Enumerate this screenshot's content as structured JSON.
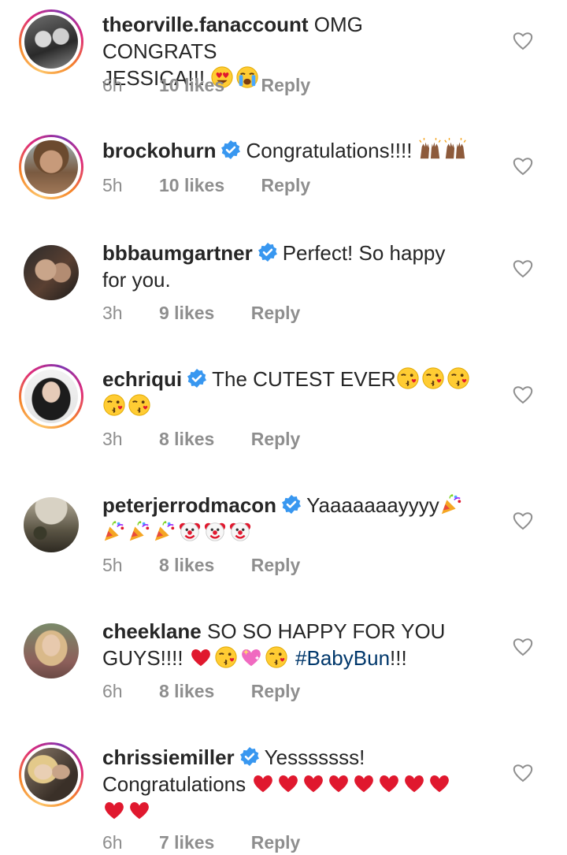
{
  "colors": {
    "text": "#262626",
    "meta": "#8e8e8e",
    "verified": "#3897f0",
    "hashtag": "#00376b",
    "heart_red": "#e0182e"
  },
  "comments": [
    {
      "username": "theorville.fanaccount",
      "verified": false,
      "has_story_ring": true,
      "text": "OMG CONGRATS JESSICA!!!",
      "emojis": [
        "heart-eyes-emoji",
        "loudly-crying-emoji"
      ],
      "time": "6h",
      "likes": "10 likes",
      "reply": "Reply"
    },
    {
      "username": "brockohurn",
      "verified": true,
      "has_story_ring": true,
      "text": "Congratulations!!!!",
      "emojis": [
        "raising-hands-emoji",
        "raising-hands-emoji"
      ],
      "time": "5h",
      "likes": "10 likes",
      "reply": "Reply"
    },
    {
      "username": "bbbaumgartner",
      "verified": true,
      "has_story_ring": false,
      "text": "Perfect!  So happy for you.",
      "emojis": [],
      "time": "3h",
      "likes": "9 likes",
      "reply": "Reply"
    },
    {
      "username": "echriqui",
      "verified": true,
      "has_story_ring": true,
      "text": "The CUTEST EVER",
      "emojis": [
        "kissing-heart-emoji",
        "kissing-heart-emoji",
        "kissing-heart-emoji",
        "kissing-heart-emoji",
        "kissing-heart-emoji"
      ],
      "time": "3h",
      "likes": "8 likes",
      "reply": "Reply"
    },
    {
      "username": "peterjerrodmacon",
      "verified": true,
      "has_story_ring": false,
      "text": "Yaaaaaaayyyy",
      "emojis": [
        "party-popper-emoji",
        "party-popper-emoji",
        "party-popper-emoji",
        "party-popper-emoji",
        "clown-emoji",
        "clown-emoji",
        "clown-emoji"
      ],
      "time": "5h",
      "likes": "8 likes",
      "reply": "Reply"
    },
    {
      "username": "cheeklane",
      "verified": false,
      "has_story_ring": false,
      "text": "SO SO HAPPY FOR YOU GUYS!!!!",
      "emojis": [
        "red-heart-emoji",
        "kissing-heart-emoji",
        "sparkling-heart-emoji",
        "kissing-heart-emoji"
      ],
      "hashtag": "#BabyBun",
      "suffix": "!!!",
      "time": "6h",
      "likes": "8 likes",
      "reply": "Reply"
    },
    {
      "username": "chrissiemiller",
      "verified": true,
      "has_story_ring": true,
      "text": "Yesssssss! Congratulations",
      "emojis": [
        "red-heart-emoji",
        "red-heart-emoji",
        "red-heart-emoji",
        "red-heart-emoji",
        "red-heart-emoji",
        "red-heart-emoji",
        "red-heart-emoji",
        "red-heart-emoji",
        "red-heart-emoji",
        "red-heart-emoji"
      ],
      "time": "6h",
      "likes": "7 likes",
      "reply": "Reply"
    }
  ],
  "text_parts": {
    "c1_line1": "OMG CONGRATS",
    "c1_line2": "JESSICA!!!",
    "c3_line1": "Perfect!  So happy",
    "c3_line2": "for you.",
    "c7_line1": "Yesssssss!",
    "c7_line2": "Congratulations"
  }
}
